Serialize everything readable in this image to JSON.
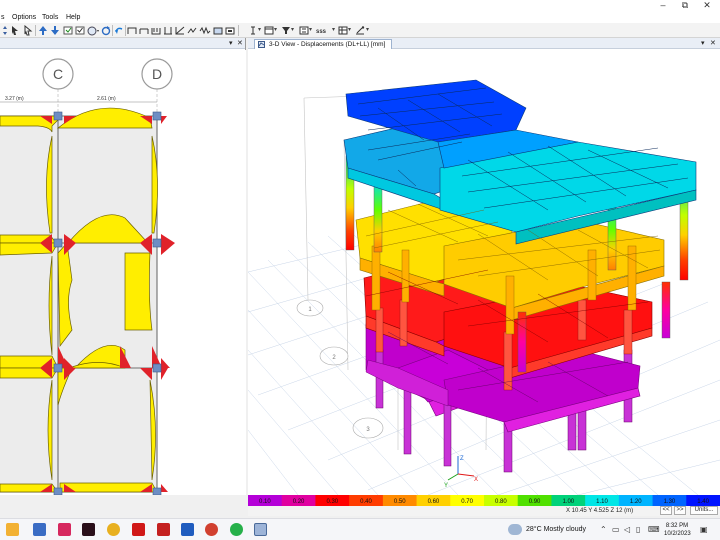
{
  "window": {
    "minimize": "–",
    "maximize": "⧉",
    "close": "✕"
  },
  "menu": {
    "items": [
      "s",
      "Options",
      "Tools",
      "Help"
    ]
  },
  "left_panel": {
    "grid_labels": [
      "C",
      "D"
    ],
    "dimensions": [
      "3.27 (m)",
      "2.61 (m)"
    ]
  },
  "right_panel": {
    "tab_title": "3-D View  - Displacements (DL+LL)  [mm]",
    "grid_bubbles": [
      "1",
      "2",
      "3"
    ],
    "axis_labels": [
      "Z",
      "Y",
      "X"
    ]
  },
  "legend": {
    "values": [
      "0.10",
      "0.20",
      "0.30",
      "0.40",
      "0.50",
      "0.60",
      "0.70",
      "0.80",
      "0.90",
      "1.00",
      "1.10",
      "1.20",
      "1.30",
      "1.40"
    ],
    "colors": [
      "#b400d8",
      "#e000a0",
      "#ff0000",
      "#ff3c00",
      "#ff8a00",
      "#ffd000",
      "#ffff00",
      "#c8ff00",
      "#50e000",
      "#00d27a",
      "#00e6e6",
      "#00b4ff",
      "#0064ff",
      "#0014ff"
    ]
  },
  "status": {
    "coords": "X 10.45  Y 4.525  Z 12 (m)",
    "nav_prev": "<<",
    "nav_next": ">>",
    "units": "Units..."
  },
  "taskbar": {
    "weather": "28°C  Mostly cloudy",
    "time": "8:32 PM",
    "date": "10/2/2023"
  }
}
